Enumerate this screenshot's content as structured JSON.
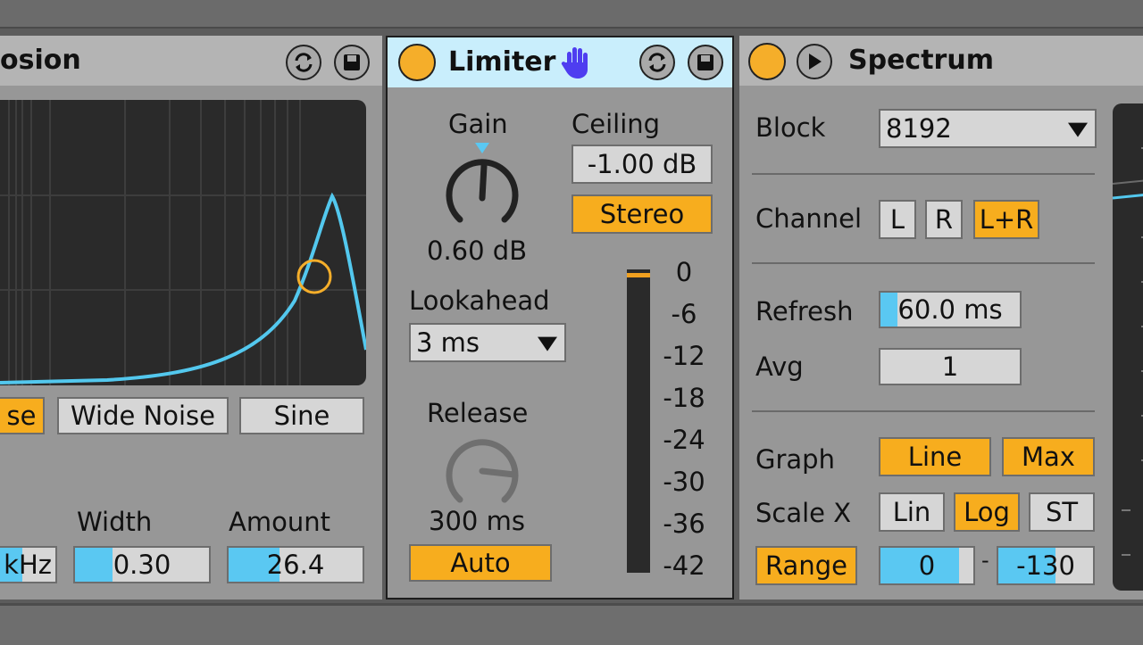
{
  "explosion": {
    "title_fragment": "osion",
    "noise_buttons": [
      "se",
      "Wide Noise",
      "Sine"
    ],
    "params": [
      {
        "label": "",
        "value": "kHz"
      },
      {
        "label": "Width",
        "value": "0.30",
        "fill": 0.28
      },
      {
        "label": "Amount",
        "value": "26.4",
        "fill": 0.38
      }
    ],
    "colors": {
      "curve": "#53c8ee",
      "marker": "#f5ae2a",
      "display_bg": "#2a2a2a"
    }
  },
  "limiter": {
    "title": "Limiter",
    "title_icon": "hand-icon",
    "gain_label": "Gain",
    "gain_value": "0.60 dB",
    "ceiling_label": "Ceiling",
    "ceiling_value": "-1.00 dB",
    "stereo_button": "Stereo",
    "lookahead_label": "Lookahead",
    "lookahead_value": "3 ms",
    "release_label": "Release",
    "release_value": "300 ms",
    "auto_button": "Auto",
    "meter_scale": [
      "0",
      "-6",
      "-12",
      "-18",
      "-24",
      "-30",
      "-36",
      "-42"
    ],
    "header_color": "#c9eefc"
  },
  "spectrum": {
    "title": "Spectrum",
    "block_label": "Block",
    "block_value": "8192",
    "channel_label": "Channel",
    "channel_buttons": [
      "L",
      "R",
      "L+R"
    ],
    "channel_selected": "L+R",
    "refresh_label": "Refresh",
    "refresh_value": "60.0 ms",
    "avg_label": "Avg",
    "avg_value": "1",
    "graph_label": "Graph",
    "graph_buttons": [
      "Line",
      "Max"
    ],
    "scalex_label": "Scale X",
    "scalex_buttons": [
      "Lin",
      "Log",
      "ST"
    ],
    "scalex_selected": "Log",
    "range_button": "Range",
    "range_min": "0",
    "range_sep": "-",
    "range_max": "-130"
  },
  "accent_color": "#f5ae2a",
  "value_fill_color": "#5ac8f2"
}
